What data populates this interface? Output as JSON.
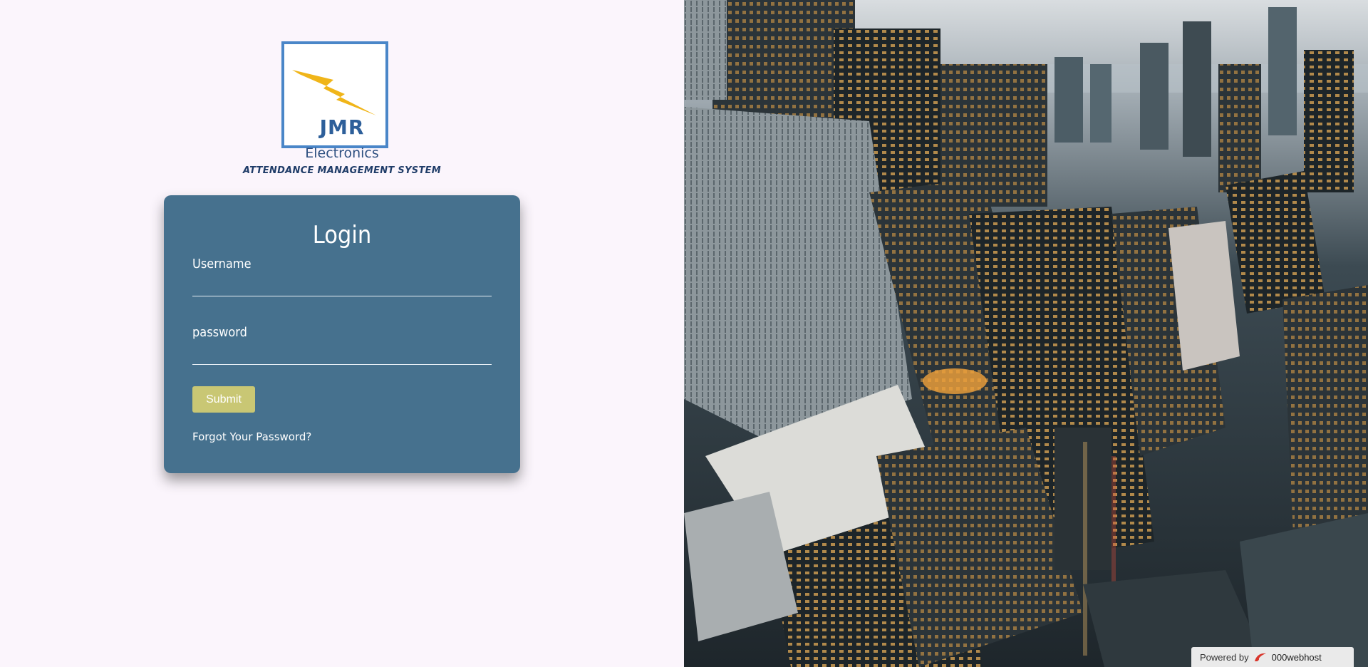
{
  "logo": {
    "brand": "JMR",
    "subbrand": "Electronics",
    "tagline": "ATTENDANCE MANAGEMENT SYSTEM"
  },
  "login": {
    "title": "Login",
    "username_label": "Username",
    "username_value": "",
    "password_label": "password",
    "password_value": "",
    "submit_label": "Submit",
    "forgot_label": "Forgot Your Password?"
  },
  "footer": {
    "powered_by": "Powered by",
    "host_name": "000webhost"
  },
  "colors": {
    "page_bg": "#fbf5fc",
    "card_bg": "#46718e",
    "submit_bg": "#c9c774",
    "logo_border": "#4a86c8",
    "bolt": "#f0b519"
  },
  "background_image": "aerial city skyline at dusk"
}
